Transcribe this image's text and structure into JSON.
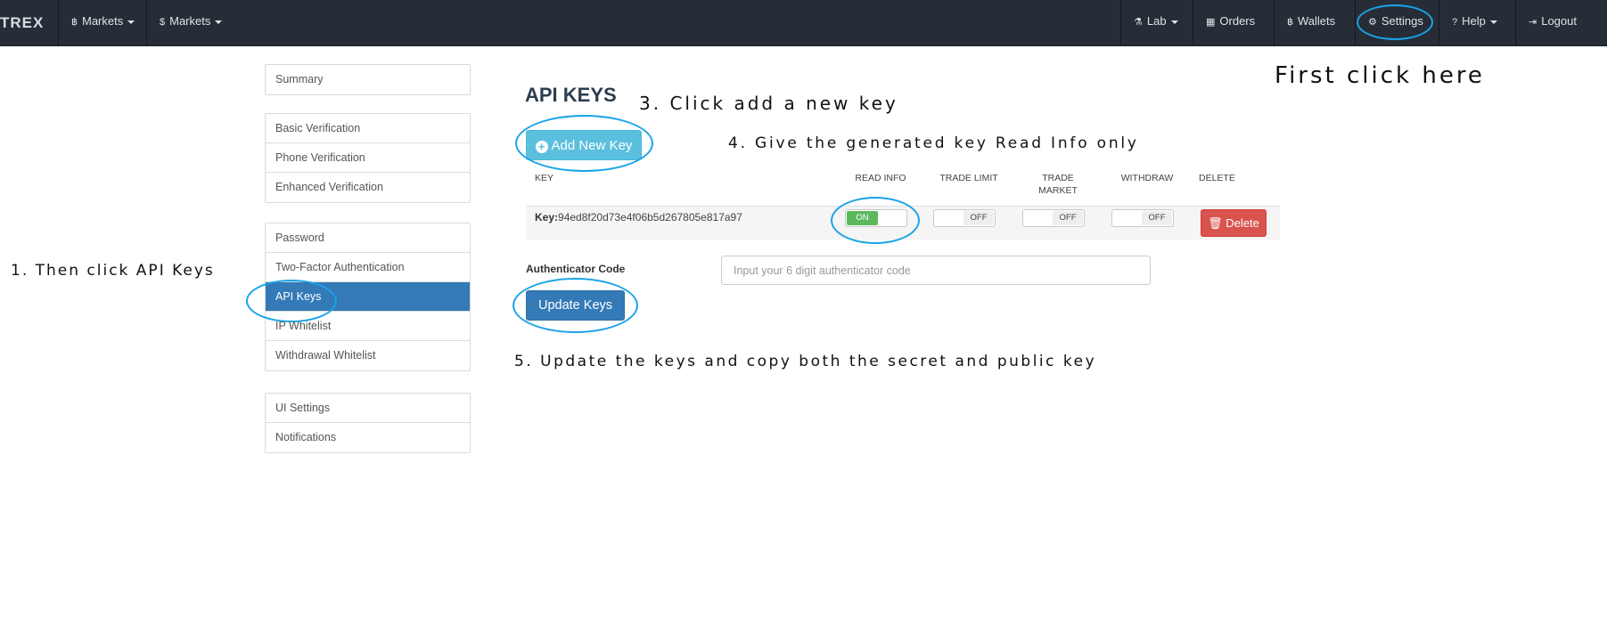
{
  "navbar": {
    "brand": "TREX",
    "left_items": [
      {
        "icon": "bitcoin-icon",
        "glyph": "฿",
        "label": "Markets"
      },
      {
        "icon": "dollar-icon",
        "glyph": "$",
        "label": "Markets"
      }
    ],
    "right_items": [
      {
        "icon": "flask-icon",
        "glyph": "⚗",
        "label": "Lab"
      },
      {
        "icon": "calendar-icon",
        "glyph": "▦",
        "label": "Orders"
      },
      {
        "icon": "bitcoin-icon",
        "glyph": "฿",
        "label": "Wallets"
      },
      {
        "icon": "gear-icon",
        "glyph": "⚙",
        "label": "Settings"
      },
      {
        "icon": "question-icon",
        "glyph": "?",
        "label": "Help"
      },
      {
        "icon": "sign-out-icon",
        "glyph": "⇥",
        "label": "Logout"
      }
    ]
  },
  "sidebar": {
    "groups": [
      [
        "Summary"
      ],
      [
        "Basic Verification",
        "Phone Verification",
        "Enhanced Verification"
      ],
      [
        "Password",
        "Two-Factor Authentication",
        "API Keys",
        "IP Whitelist",
        "Withdrawal Whitelist"
      ],
      [
        "UI Settings",
        "Notifications"
      ]
    ],
    "active": "API Keys"
  },
  "main": {
    "title": "API KEYS",
    "add_button": "Add New Key",
    "columns": {
      "key": "KEY",
      "read_info": "READ INFO",
      "trade_limit": "TRADE LIMIT",
      "trade_market": "TRADE MARKET",
      "withdraw": "WITHDRAW",
      "delete": "DELETE"
    },
    "row": {
      "key_prefix": "Key:",
      "key_value": "94ed8f20d73e4f06b5d267805e817a97",
      "read_info": {
        "on_label": "ON",
        "state": "on"
      },
      "trade_limit": {
        "off_label": "OFF",
        "state": "off"
      },
      "trade_market": {
        "off_label": "OFF",
        "state": "off"
      },
      "withdraw": {
        "off_label": "OFF",
        "state": "off"
      },
      "delete_label": "Delete"
    },
    "auth_label": "Authenticator Code",
    "auth_placeholder": "Input your 6 digit authenticator code",
    "update_button": "Update Keys"
  },
  "annotations": {
    "first": "First click here",
    "step1": "1. Then click API Keys",
    "step3": "3. Click add a new key",
    "step4": "4. Give the generated key Read Info only",
    "step5": "5. Update the keys and copy both the secret and public key"
  },
  "colors": {
    "navbar": "#262d36",
    "active": "#337ab7",
    "info_button": "#5bc0de",
    "danger": "#d9534f",
    "success": "#5cb85c",
    "annotation_circle": "#1aa3e8"
  }
}
